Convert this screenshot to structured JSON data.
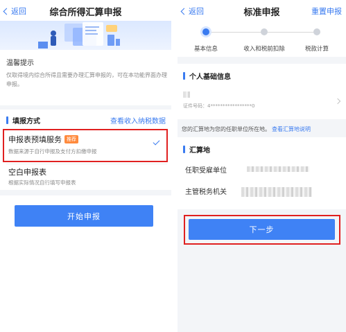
{
  "left": {
    "nav": {
      "back_label": "返回",
      "title": "综合所得汇算申报"
    },
    "tip": {
      "title": "温馨提示",
      "text": "仅取得境内综合所得且需要办理汇算申报的，可在本功能界面办理申报。"
    },
    "fill_method": {
      "heading": "填报方式",
      "view_link": "查看收入纳税数据",
      "options": [
        {
          "title": "申报表预填服务",
          "tag": "推荐",
          "subtitle": "数据来源于自行申报及支付方扣缴申报",
          "selected": true
        },
        {
          "title": "空白申报表",
          "subtitle": "根据实际情况自行填写申报表",
          "selected": false
        }
      ]
    },
    "start_button": "开始申报"
  },
  "right": {
    "nav": {
      "back_label": "返回",
      "title": "标准申报",
      "reset": "重置申报"
    },
    "steps": [
      {
        "label": "基本信息",
        "active": true
      },
      {
        "label": "收入和税前扣除",
        "active": false
      },
      {
        "label": "税款计算",
        "active": false
      }
    ],
    "personal_info": {
      "heading": "个人基础信息",
      "id_line": "证件号码：4*****************0"
    },
    "notice": {
      "text": "您的汇算地为您的任职单位所在地。",
      "link": "查看汇算地说明"
    },
    "settlement": {
      "heading": "汇算地",
      "rows": [
        {
          "label": "任职受雇单位"
        },
        {
          "label": "主管税务机关"
        }
      ]
    },
    "next_button": "下一步"
  },
  "colors": {
    "accent": "#3a7bf0",
    "button": "#3f82f5",
    "highlight_border": "#e02020",
    "recommend_tag": "#ff8a3d"
  }
}
